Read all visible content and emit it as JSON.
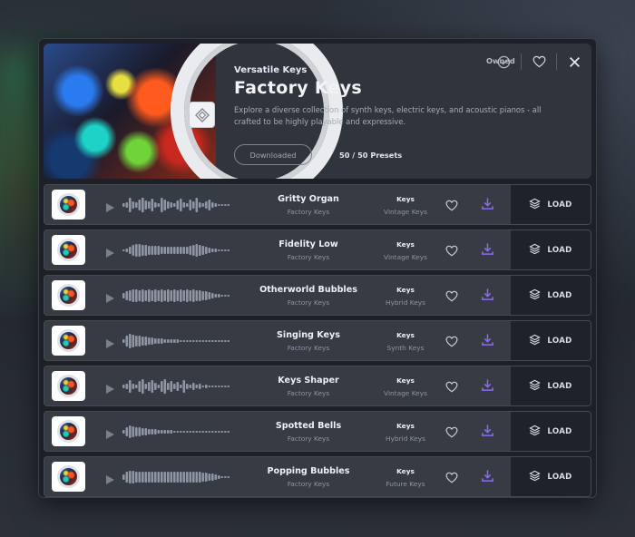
{
  "pack": {
    "subtitle": "Versatile Keys",
    "title": "Factory Keys",
    "description": "Explore a diverse collection of synth keys, electric keys, and acoustic pianos - all crafted to be highly playable and expressive.",
    "download_status": "Downloaded",
    "preset_count": "50 / 50 Presets",
    "owned_label": "Owned"
  },
  "colors": {
    "accent": "#8b6cf0",
    "panel": "#1d2026",
    "row": "#363b44"
  },
  "icons": {
    "owned": "check-circle-icon",
    "favorite": "heart-icon",
    "close": "close-icon",
    "play": "play-icon",
    "download": "download-icon",
    "load": "layers-icon"
  },
  "load_label": "LOAD",
  "presets": [
    {
      "name": "Gritty Organ",
      "library": "Factory Keys",
      "category": "Keys",
      "subcategory": "Vintage Keys"
    },
    {
      "name": "Fidelity Low",
      "library": "Factory Keys",
      "category": "Keys",
      "subcategory": "Vintage Keys"
    },
    {
      "name": "Otherworld Bubbles",
      "library": "Factory Keys",
      "category": "Keys",
      "subcategory": "Hybrid Keys"
    },
    {
      "name": "Singing Keys",
      "library": "Factory Keys",
      "category": "Keys",
      "subcategory": "Synth Keys"
    },
    {
      "name": "Keys Shaper",
      "library": "Factory Keys",
      "category": "Keys",
      "subcategory": "Vintage Keys"
    },
    {
      "name": "Spotted Bells",
      "library": "Factory Keys",
      "category": "Keys",
      "subcategory": "Hybrid Keys"
    },
    {
      "name": "Popping Bubbles",
      "library": "Factory Keys",
      "category": "Keys",
      "subcategory": "Future Keys"
    }
  ]
}
